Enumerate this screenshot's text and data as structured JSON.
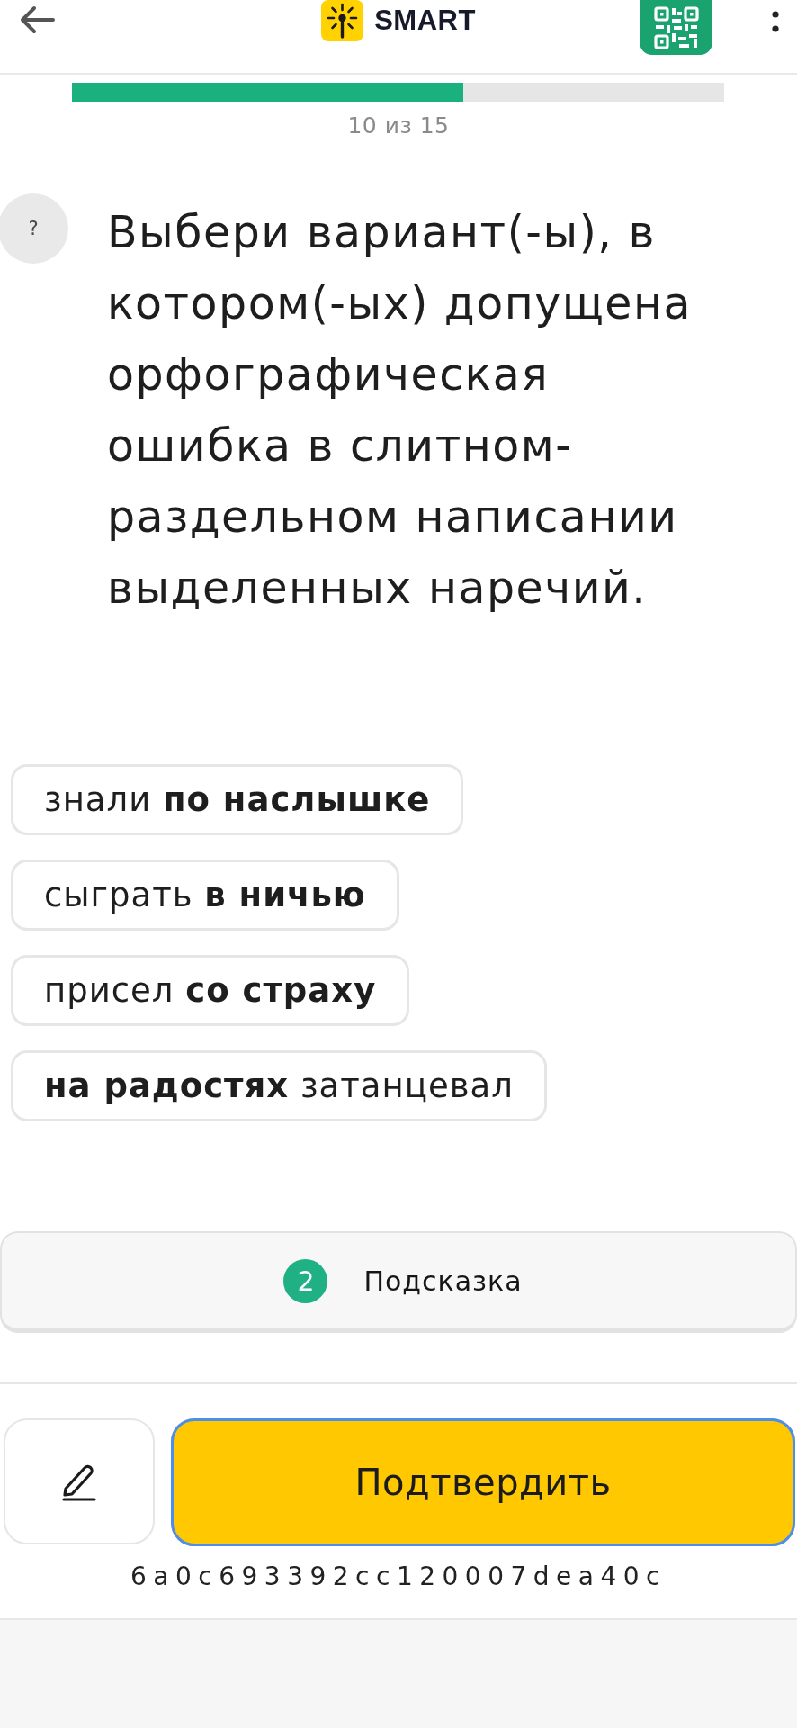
{
  "header": {
    "logo_text": "SMART"
  },
  "progress": {
    "level": 0.6,
    "label": "10 из 15"
  },
  "question": {
    "help": "?",
    "text": "Выбери вариант(-ы), в котором(-ых) допущена орфографическая ошибка в слитном-раздельном написании выделенных наречий."
  },
  "options": [
    {
      "text": "знали **по наслышке**",
      "selected": false
    },
    {
      "text": "сыграть **в ничью**",
      "selected": false
    },
    {
      "text": "присел **со страху**",
      "selected": false
    },
    {
      "text": "**на радостях** затанцевал",
      "selected": false
    }
  ],
  "hint": {
    "count": "2",
    "label": "Подсказка"
  },
  "confirm": {
    "label": "Подтвердить",
    "focused": true
  },
  "attempt_id": "6a0c693392cc120007dea40c"
}
